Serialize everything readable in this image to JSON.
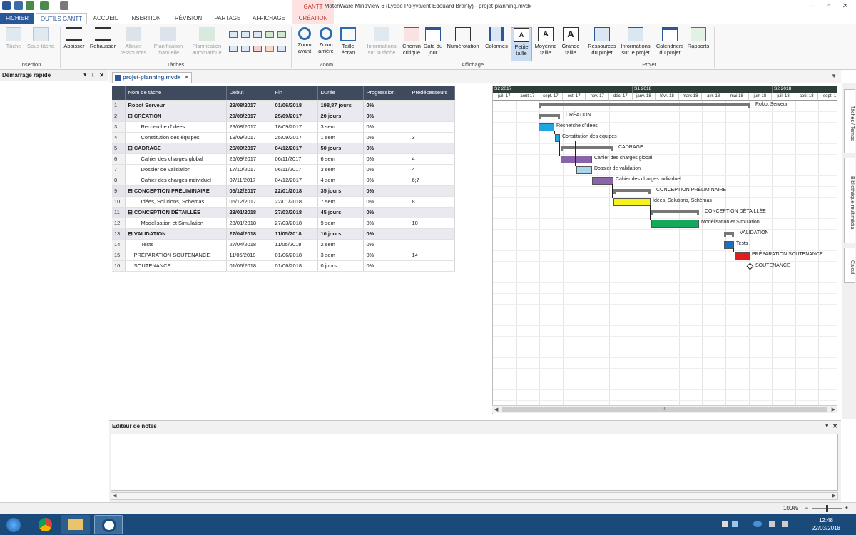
{
  "window": {
    "title": "MatchWare MindView 6 (Lycee Polyvalent Edouard Branly) - projet-planning.mvdx",
    "context_label": "GANTT",
    "controls": [
      "–",
      "▫",
      "✕"
    ]
  },
  "tabs": [
    "FICHIER",
    "OUTILS GANTT",
    "ACCUEIL",
    "INSERTION",
    "RÉVISION",
    "PARTAGE",
    "AFFICHAGE",
    "CRÉATION"
  ],
  "ribbon": {
    "insertion": {
      "group": "Insertion",
      "tache": "Tâche",
      "sous_tache": "Sous-tâche"
    },
    "taches": {
      "group": "Tâches",
      "abaisser": "Abaisser",
      "rehausser": "Rehausser",
      "allouer": "Allouer ressources",
      "planif_manuelle": "Planification manuelle",
      "planif_auto": "Planification automatique"
    },
    "zoom": {
      "group": "Zoom",
      "avant": "Zoom avant",
      "arriere": "Zoom arrière",
      "taille_ecran": "Taille écran"
    },
    "affichage": {
      "group": "Affichage",
      "informations": "Informations sur la tâche",
      "chemin": "Chemin critique",
      "date": "Date du jour",
      "numerotation": "Numérotation",
      "colonnes": "Colonnes",
      "petite": "Petite taille",
      "moyenne": "Moyenne taille",
      "grande": "Grande taille"
    },
    "projet": {
      "group": "Projet",
      "ressources": "Ressources du projet",
      "infos": "Informations sur le projet",
      "calendriers": "Calendriers du projet",
      "rapports": "Rapports"
    }
  },
  "left_pane": {
    "title": "Démarrage rapide",
    "icons": [
      "pin-icon",
      "close-icon"
    ]
  },
  "document_tab": "projet-planning.mvdx",
  "table": {
    "headers": [
      "Nom de tâche",
      "Début",
      "Fin",
      "Durée",
      "Progression",
      "Prédécesseurs"
    ],
    "rows": [
      {
        "n": "1",
        "name": "Robot Serveur",
        "start": "29/08/2017",
        "end": "01/06/2018",
        "dur": "198,87 jours",
        "prog": "0%",
        "pred": "",
        "summary": true
      },
      {
        "n": "2",
        "name": "⊟ CRÉATION",
        "start": "29/08/2017",
        "end": "25/09/2017",
        "dur": "20 jours",
        "prog": "0%",
        "pred": "",
        "summary": true
      },
      {
        "n": "3",
        "name": "Recherche d'idées",
        "start": "29/08/2017",
        "end": "18/09/2017",
        "dur": "3 sem",
        "prog": "0%",
        "pred": "",
        "summary": false
      },
      {
        "n": "4",
        "name": "Constitution des équipes",
        "start": "19/09/2017",
        "end": "25/09/2017",
        "dur": "1 sem",
        "prog": "0%",
        "pred": "3",
        "summary": false
      },
      {
        "n": "5",
        "name": "⊟ CADRAGE",
        "start": "26/09/2017",
        "end": "04/12/2017",
        "dur": "50 jours",
        "prog": "0%",
        "pred": "",
        "summary": true
      },
      {
        "n": "6",
        "name": "Cahier des charges global",
        "start": "26/09/2017",
        "end": "06/11/2017",
        "dur": "6 sem",
        "prog": "0%",
        "pred": "4",
        "summary": false
      },
      {
        "n": "7",
        "name": "Dossier de validation",
        "start": "17/10/2017",
        "end": "06/11/2017",
        "dur": "3 sem",
        "prog": "0%",
        "pred": "4",
        "summary": false
      },
      {
        "n": "8",
        "name": "Cahier des charges individuel",
        "start": "07/11/2017",
        "end": "04/12/2017",
        "dur": "4 sem",
        "prog": "0%",
        "pred": "6;7",
        "summary": false
      },
      {
        "n": "9",
        "name": "⊟ CONCEPTION PRÉLIMINAIRE",
        "start": "05/12/2017",
        "end": "22/01/2018",
        "dur": "35 jours",
        "prog": "0%",
        "pred": "",
        "summary": true
      },
      {
        "n": "10",
        "name": "Idées, Solutions, Schémas",
        "start": "05/12/2017",
        "end": "22/01/2018",
        "dur": "7 sem",
        "prog": "0%",
        "pred": "8",
        "summary": false
      },
      {
        "n": "11",
        "name": "⊟ CONCEPTION DÉTAILLÉE",
        "start": "23/01/2018",
        "end": "27/03/2018",
        "dur": "45 jours",
        "prog": "0%",
        "pred": "",
        "summary": true
      },
      {
        "n": "12",
        "name": "Modélisation et Simulation",
        "start": "23/01/2018",
        "end": "27/03/2018",
        "dur": "9 sem",
        "prog": "0%",
        "pred": "10",
        "summary": false
      },
      {
        "n": "13",
        "name": "⊟ VALIDATION",
        "start": "27/04/2018",
        "end": "11/05/2018",
        "dur": "10 jours",
        "prog": "0%",
        "pred": "",
        "summary": true
      },
      {
        "n": "14",
        "name": "Tests",
        "start": "27/04/2018",
        "end": "11/05/2018",
        "dur": "2 sem",
        "prog": "0%",
        "pred": "",
        "summary": false
      },
      {
        "n": "15",
        "name": "PRÉPARATION SOUTENANCE",
        "start": "11/05/2018",
        "end": "01/06/2018",
        "dur": "3 sem",
        "prog": "0%",
        "pred": "14",
        "summary": false
      },
      {
        "n": "16",
        "name": "SOUTENANCE",
        "start": "01/06/2018",
        "end": "01/06/2018",
        "dur": "0 jours",
        "prog": "0%",
        "pred": "",
        "summary": false
      }
    ]
  },
  "gantt": {
    "semesters": [
      "S2 2017",
      "S1 2018",
      "S2 2018"
    ],
    "months": [
      "juil. 17",
      "août 17",
      "sept. 17",
      "oct. 17",
      "nov. 17",
      "déc. 17",
      "janv. 18",
      "févr. 18",
      "mars 18",
      "avr. 18",
      "mai 18",
      "juin 18",
      "juil. 18",
      "août 18",
      "sept. 1"
    ],
    "labels": [
      "Robot Serveur",
      "CRÉATION",
      "Recherche d'idées",
      "Constitution des équipes",
      "CADRAGE",
      "Cahier des charges global",
      "Dossier de validation",
      "Cahier des charges individuel",
      "CONCEPTION PRÉLIMINAIRE",
      "Idées, Solutions, Schémas",
      "CONCEPTION DÉTAILLÉE",
      "Modélisation et Simulation",
      "VALIDATION",
      "Tests",
      "PRÉPARATION SOUTENANCE",
      "SOUTENANCE"
    ],
    "colors": {
      "creation": "#1ea7e1",
      "cadrage": "#8a63a8",
      "validation": "#a9d6ea",
      "prelim": "#f6f31a",
      "detail": "#16a85a",
      "tests": "#1a6fbf",
      "soutenance": "#e51b1b"
    },
    "scroll_thumb": "III"
  },
  "right_tabs": [
    "Tâches / Temps",
    "Bibliothèque multimédia",
    "Calcul"
  ],
  "notes": {
    "title": "Editeur de notes"
  },
  "status": {
    "zoom": "100%",
    "minus": "−",
    "plus": "+"
  },
  "clock": {
    "time": "12:48",
    "date": "22/03/2018"
  }
}
